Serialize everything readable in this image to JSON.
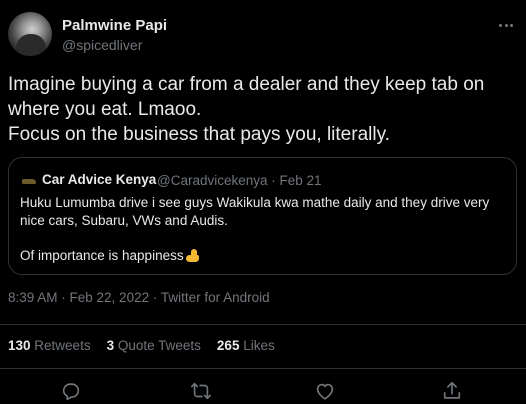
{
  "author": {
    "display_name": "Palmwine Papi",
    "handle": "@spicedliver"
  },
  "tweet": {
    "text": "Imagine buying a car from a dealer and they keep tab on where you eat. Lmaoo.\nFocus on the business that pays you, literally."
  },
  "quote": {
    "display_name": "Car Advice Kenya",
    "meta": "@Caradvicekenya · Feb 21",
    "text": "Huku Lumumba drive i see guys Wakikula kwa mathe daily and they drive very nice cars, Subaru, VWs and Audis.",
    "text2": "Of importance is happiness",
    "emoji": "flexed-biceps-icon"
  },
  "timestamp": "8:39 AM · Feb 22, 2022 · Twitter for Android",
  "stats": {
    "retweets_count": "130",
    "retweets_label": "Retweets",
    "quotes_count": "3",
    "quotes_label": "Quote Tweets",
    "likes_count": "265",
    "likes_label": "Likes"
  },
  "colors": {
    "background": "#000000",
    "text": "#e7e9ea",
    "muted": "#71767b",
    "border": "#2f3336"
  },
  "icons": [
    "more-icon",
    "reply-icon",
    "retweet-icon",
    "like-icon",
    "share-icon"
  ]
}
